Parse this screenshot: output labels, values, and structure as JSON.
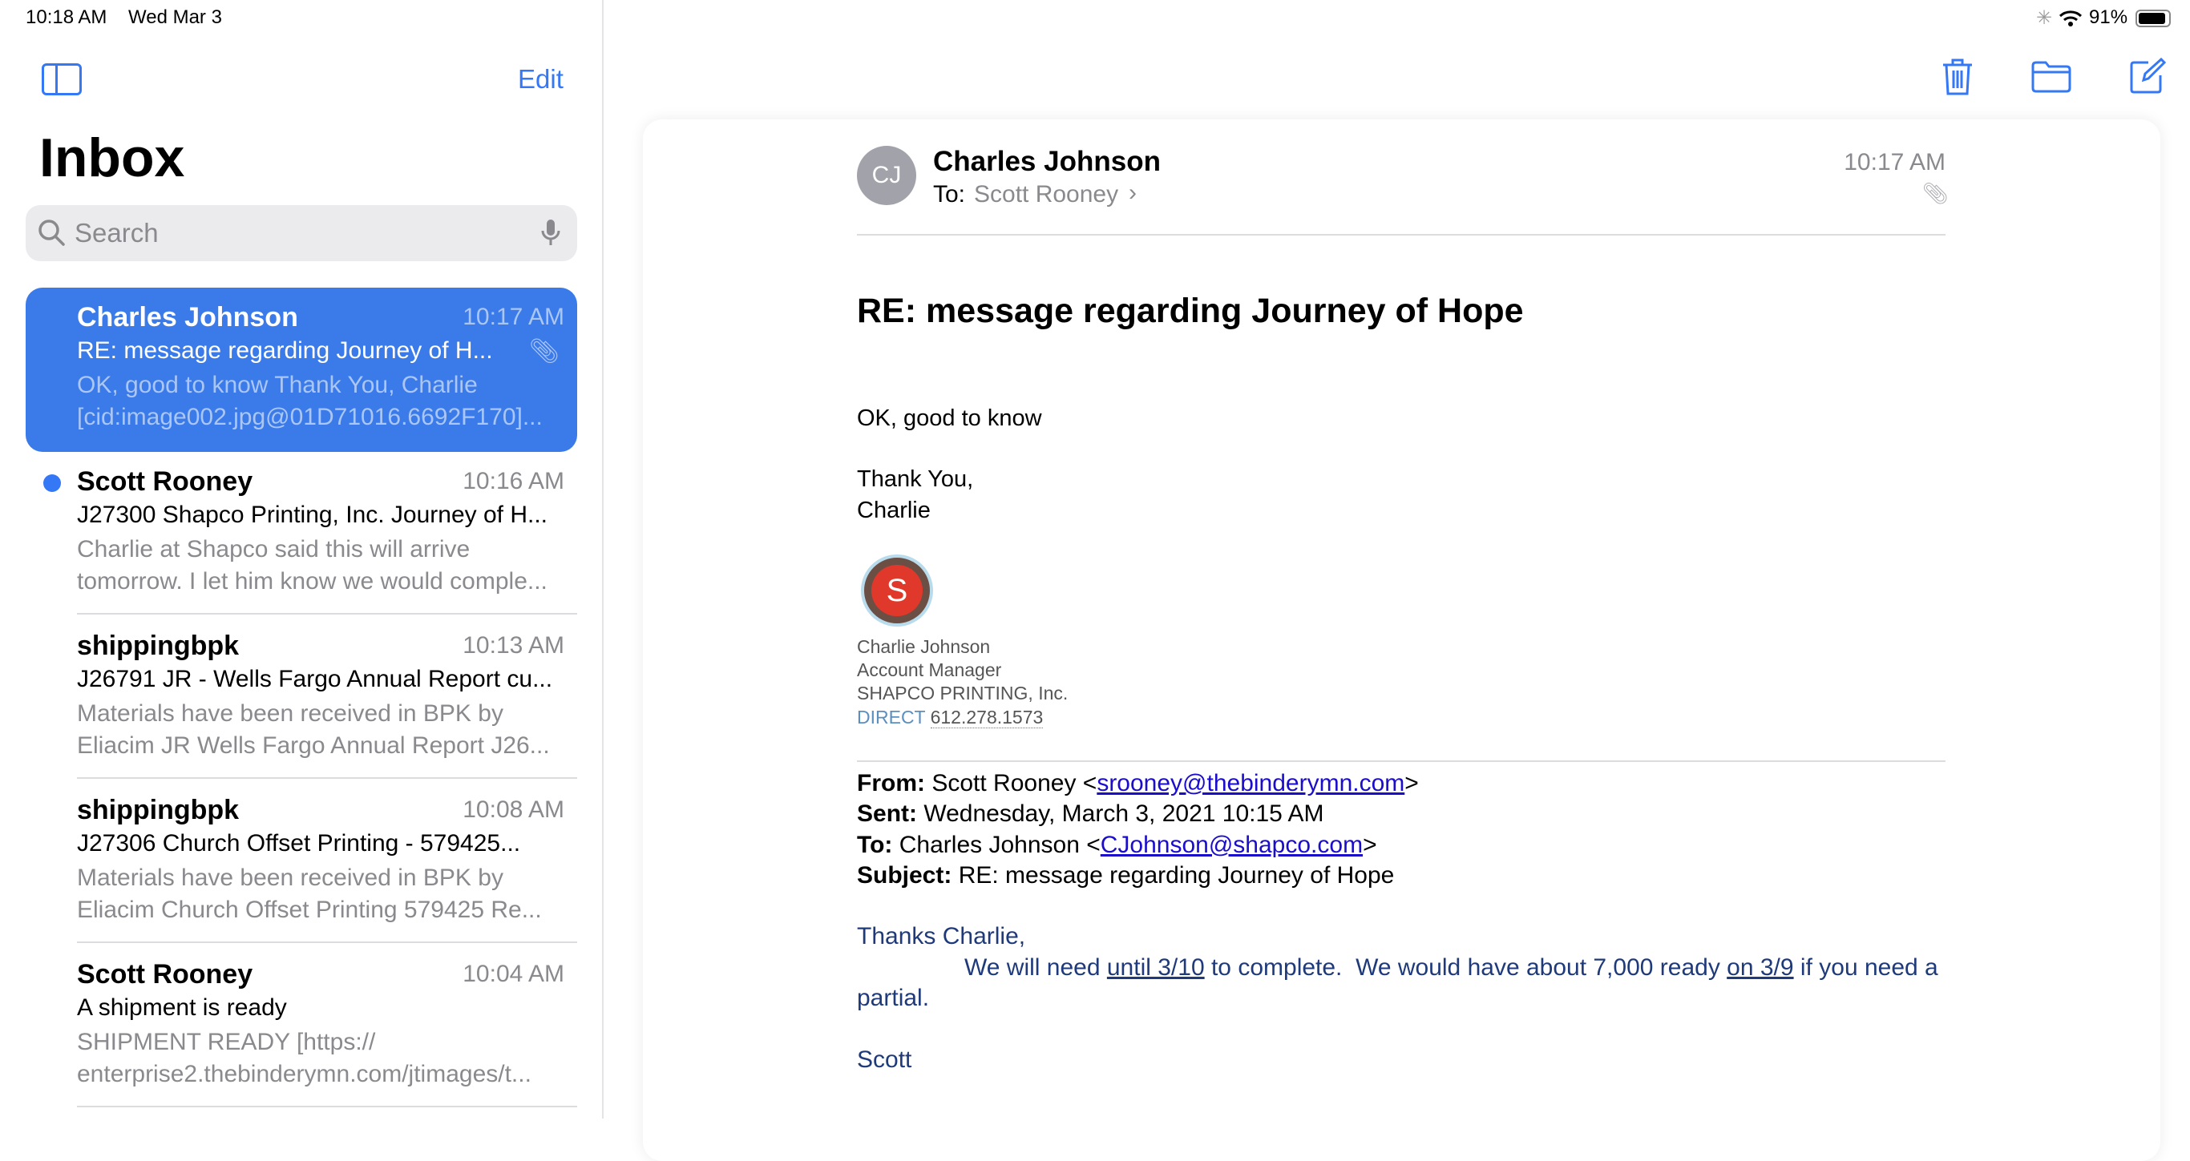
{
  "status_bar": {
    "time": "10:18 AM",
    "date": "Wed Mar 3",
    "battery": "91%"
  },
  "sidebar": {
    "edit_label": "Edit",
    "title": "Inbox",
    "search_placeholder": "Search",
    "messages": [
      {
        "sender": "Charles Johnson",
        "time": "10:17 AM",
        "subject": "RE: message regarding Journey of H...",
        "preview1": "OK, good to know Thank You, Charlie",
        "preview2": "[cid:image002.jpg@01D71016.6692F170]...",
        "selected": true,
        "attachment": true
      },
      {
        "sender": "Scott Rooney",
        "time": "10:16 AM",
        "subject": "J27300 Shapco Printing, Inc. Journey of H...",
        "preview1": "Charlie at Shapco said this will arrive",
        "preview2": "tomorrow. I let him know we would comple...",
        "unread": true
      },
      {
        "sender": "shippingbpk",
        "time": "10:13 AM",
        "subject": "J26791 JR - Wells Fargo Annual Report cu...",
        "preview1": "Materials have been received in BPK by",
        "preview2": "Eliacim JR Wells Fargo Annual Report J26..."
      },
      {
        "sender": "shippingbpk",
        "time": "10:08 AM",
        "subject": "J27306 Church Offset Printing - 579425...",
        "preview1": "Materials have been received in BPK by",
        "preview2": "Eliacim Church Offset Printing 579425 Re..."
      },
      {
        "sender": "Scott Rooney",
        "time": "10:04 AM",
        "subject": "A shipment is ready",
        "preview1": "SHIPMENT READY [https://",
        "preview2": "enterprise2.thebinderymn.com/jtimages/t..."
      }
    ]
  },
  "message": {
    "avatar_initials": "CJ",
    "sender": "Charles Johnson",
    "to_label": "To:",
    "to": "Scott Rooney",
    "time": "10:17 AM",
    "subject": "RE: message regarding Journey of Hope",
    "body": [
      "OK, good to know",
      "Thank You,",
      "Charlie"
    ],
    "logo_letter": "S",
    "signature": {
      "name": "Charlie Johnson",
      "title": "Account Manager",
      "company": "SHAPCO PRINTING, Inc.",
      "direct_label": "DIRECT",
      "phone": "612.278.1573"
    },
    "quoted": {
      "from_label": "From:",
      "from_name": "Scott Rooney <",
      "from_email": "srooney@thebinderymn.com",
      "close": ">",
      "sent_label": "Sent:",
      "sent": "Wednesday, March 3, 2021 10:15 AM",
      "to_label": "To:",
      "to_name": "Charles Johnson <",
      "to_email": "CJohnson@shapco.com",
      "subject_label": "Subject:",
      "subject": "RE: message regarding Journey of Hope",
      "greeting": "Thanks Charlie,",
      "line_a": "We will need ",
      "link_a": "until 3/10",
      "line_b": " to complete.  We would have about 7,000 ready ",
      "link_b": "on 3/9",
      "line_c": " if you need a",
      "line_d": "partial.",
      "signoff": "Scott"
    }
  }
}
